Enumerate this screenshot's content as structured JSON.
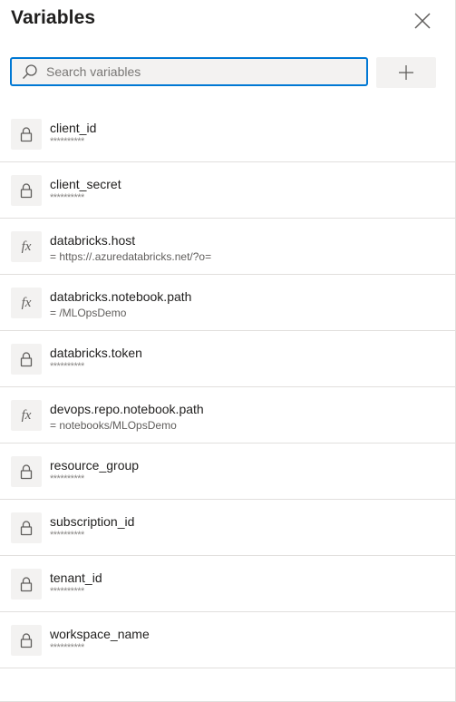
{
  "panel": {
    "title": "Variables",
    "close_icon": "close-icon",
    "accent_color": "#0078d4"
  },
  "search": {
    "placeholder": "Search variables",
    "value": "",
    "icon": "search-icon"
  },
  "add_button": {
    "icon": "plus-icon"
  },
  "variables": [
    {
      "name": "client_id",
      "value": "**********",
      "icon": "lock-icon",
      "secret": true
    },
    {
      "name": "client_secret",
      "value": "**********",
      "icon": "lock-icon",
      "secret": true
    },
    {
      "name": "databricks.host",
      "value": "= https://.azuredatabricks.net/?o=",
      "icon": "fx-icon",
      "secret": false
    },
    {
      "name": "databricks.notebook.path",
      "value": "= /MLOpsDemo",
      "icon": "fx-icon",
      "secret": false
    },
    {
      "name": "databricks.token",
      "value": "**********",
      "icon": "lock-icon",
      "secret": true
    },
    {
      "name": "devops.repo.notebook.path",
      "value": "= notebooks/MLOpsDemo",
      "icon": "fx-icon",
      "secret": false
    },
    {
      "name": "resource_group",
      "value": "**********",
      "icon": "lock-icon",
      "secret": true
    },
    {
      "name": "subscription_id",
      "value": "**********",
      "icon": "lock-icon",
      "secret": true
    },
    {
      "name": "tenant_id",
      "value": "**********",
      "icon": "lock-icon",
      "secret": true
    },
    {
      "name": "workspace_name",
      "value": "**********",
      "icon": "lock-icon",
      "secret": true
    }
  ]
}
